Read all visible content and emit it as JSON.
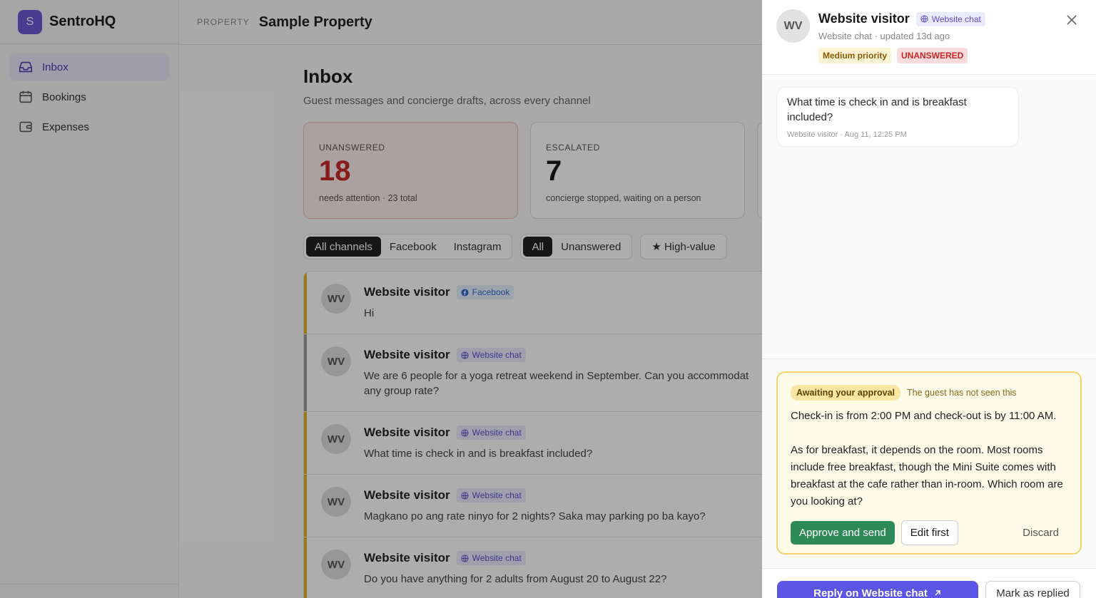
{
  "app": {
    "name": "SentroHQ",
    "logo_letter": "S"
  },
  "sidebar": {
    "items": [
      {
        "label": "Inbox",
        "icon": "inbox-icon",
        "active": true
      },
      {
        "label": "Bookings",
        "icon": "calendar-icon"
      },
      {
        "label": "Expenses",
        "icon": "wallet-icon"
      }
    ]
  },
  "topbar": {
    "property_label": "PROPERTY",
    "property_name": "Sample Property"
  },
  "inbox": {
    "title": "Inbox",
    "subtitle": "Guest messages and concierge drafts, across every channel",
    "stats": [
      {
        "label": "UNANSWERED",
        "value": "18",
        "note": "needs attention · 23 total"
      },
      {
        "label": "ESCALATED",
        "value": "7",
        "note": "concierge stopped, waiting on a person"
      }
    ],
    "channel_filters": [
      "All channels",
      "Facebook",
      "Instagram"
    ],
    "status_filters": [
      "All",
      "Unanswered"
    ],
    "high_value_label": "★ High-value",
    "rows": [
      {
        "initials": "WV",
        "name": "Website visitor",
        "channel": "Facebook",
        "message": "Hi"
      },
      {
        "initials": "WV",
        "name": "Website visitor",
        "channel": "Website chat",
        "message_line1": "We are 6 people for a yoga retreat weekend in September. Can you accommodat",
        "message_line2": "any group rate?"
      },
      {
        "initials": "WV",
        "name": "Website visitor",
        "channel": "Website chat",
        "message": "What time is check in and is breakfast included?"
      },
      {
        "initials": "WV",
        "name": "Website visitor",
        "channel": "Website chat",
        "message": "Magkano po ang rate ninyo for 2 nights? Saka may parking po ba kayo?"
      },
      {
        "initials": "WV",
        "name": "Website visitor",
        "channel": "Website chat",
        "message": "Do you have anything for 2 adults from August 20 to August 22?"
      }
    ]
  },
  "panel": {
    "initials": "WV",
    "name": "Website visitor",
    "channel": "Website chat",
    "meta": "Website chat · updated 13d ago",
    "priority": "Medium priority",
    "status": "UNANSWERED",
    "message": {
      "text": "What time is check in and is breakfast included?",
      "meta": "Website visitor · Aug 11, 12:25 PM"
    },
    "draft": {
      "badge": "Awaiting your approval",
      "note": "The guest has not seen this",
      "text": "Check-in is from 2:00 PM and check-out is by 11:00 AM.\n\nAs for breakfast, it depends on the room. Most rooms include free breakfast, though the Mini Suite comes with breakfast at the cafe rather than in-room. Which room are you looking at?",
      "approve": "Approve and send",
      "edit": "Edit first",
      "discard": "Discard"
    },
    "footer": {
      "reply": "Reply on Website chat",
      "mark": "Mark as replied"
    }
  },
  "colors": {
    "accent": "#5a55e3",
    "brand": "#6d5bd6",
    "approve": "#2e8b57",
    "danger": "#c62828",
    "draft_border": "#f3d36a"
  }
}
